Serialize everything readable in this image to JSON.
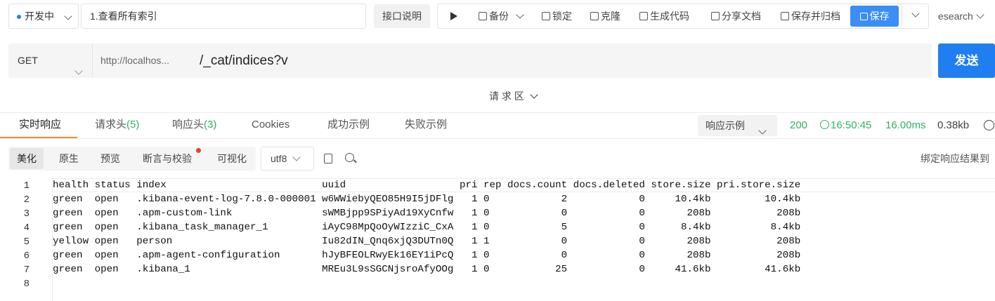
{
  "toolbar": {
    "status": "开发中",
    "status_color": "#2f7cf6",
    "api_name": "1.查看所有索引",
    "api_doc_btn": "接口说明",
    "run_icon": "play-icon",
    "backup": "备份",
    "lock": "锁定",
    "clone": "克隆",
    "gen_code": "生成代码",
    "share_doc": "分享文档",
    "save_archive": "保存并归档",
    "save": "保存",
    "env": "esearch"
  },
  "request": {
    "method": "GET",
    "base_url": "http://localhos...",
    "path": "/_cat/indices?v",
    "send": "发送",
    "send_color": "#1f7ef0",
    "area_toggle": "请 求 区"
  },
  "response_tabs": {
    "tabs": [
      "实时响应",
      "请求头",
      "(5)",
      "响应头",
      "(3)",
      "Cookies",
      "成功示例",
      "失败示例"
    ],
    "example_select": "响应示例",
    "status_code": "200",
    "time": "16:50:45",
    "duration": "16.00ms",
    "size": "0.38kb",
    "status_color": "#2fb36a"
  },
  "view_tabs": {
    "items": [
      "美化",
      "原生",
      "预览",
      "断言与校验",
      "可视化"
    ],
    "encoding": "utf8",
    "bind_result": "绑定响应结果到"
  },
  "table": {
    "header": [
      "health",
      "status",
      "index",
      "uuid",
      "pri",
      "rep",
      "docs.count",
      "docs.deleted",
      "store.size",
      "pri.store.size"
    ],
    "rows": [
      [
        "green",
        "open",
        ".kibana-event-log-7.8.0-000001",
        "w6WWiebyQEO85H9I5jDFlg",
        "1",
        "0",
        "2",
        "0",
        "10.4kb",
        "10.4kb"
      ],
      [
        "green",
        "open",
        ".apm-custom-link",
        "sWMBjpp9SPiyAd19XyCnfw",
        "1",
        "0",
        "0",
        "0",
        "208b",
        "208b"
      ],
      [
        "green",
        "open",
        ".kibana_task_manager_1",
        "iAyC98MpQoOyWIzziC_CxA",
        "1",
        "0",
        "5",
        "0",
        "8.4kb",
        "8.4kb"
      ],
      [
        "yellow",
        "open",
        "person",
        "Iu82dIN_Qnq6xjQ3DUTn0Q",
        "1",
        "1",
        "0",
        "0",
        "208b",
        "208b"
      ],
      [
        "green",
        "open",
        ".apm-agent-configuration",
        "hJyBFEOLRwyEk16EY1iPcQ",
        "1",
        "0",
        "0",
        "0",
        "208b",
        "208b"
      ],
      [
        "green",
        "open",
        ".kibana_1",
        "MREu3L9sSGCNjsroAfyOOg",
        "1",
        "0",
        "25",
        "0",
        "41.6kb",
        "41.6kb"
      ]
    ],
    "line_numbers": [
      "1",
      "2",
      "3",
      "4",
      "5",
      "6",
      "7",
      "8"
    ]
  }
}
